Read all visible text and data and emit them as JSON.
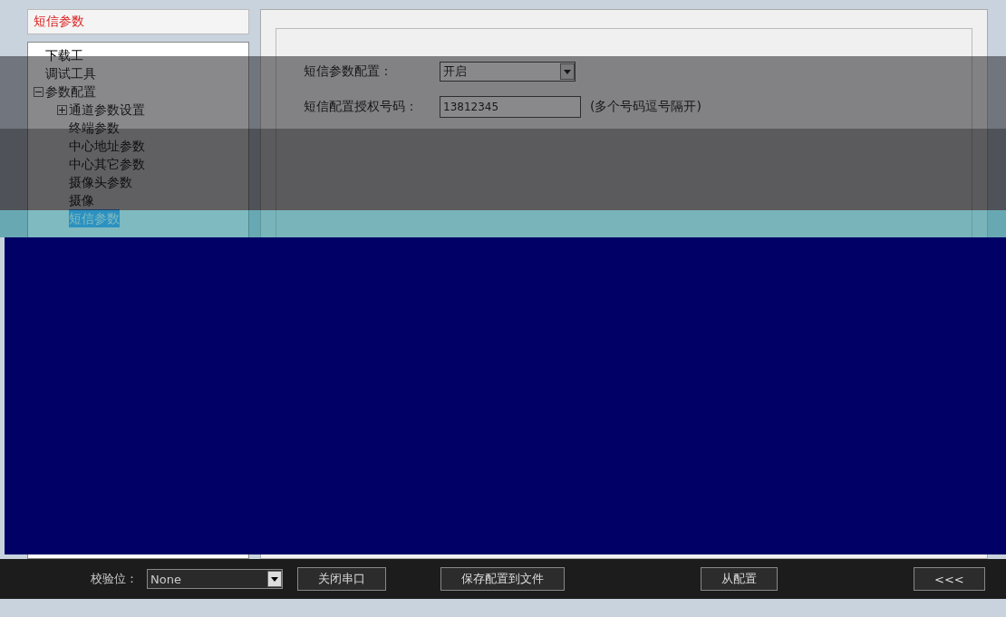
{
  "sidebar": {
    "title": "短信参数",
    "tree": [
      {
        "label": "下载工",
        "selected": false
      },
      {
        "label": "调试工具",
        "selected": false
      },
      {
        "label": "参数配置",
        "selected": false,
        "expanded": true,
        "children": [
          {
            "label": "通道参数设置",
            "selected": false,
            "expanded": false
          },
          {
            "label": "终端参数",
            "selected": false
          },
          {
            "label": "中心地址参数",
            "selected": false
          },
          {
            "label": "中心其它参数",
            "selected": false
          },
          {
            "label": "摄像头参数",
            "selected": false
          },
          {
            "label": "摄像",
            "selected": false
          },
          {
            "label": "短信参数",
            "selected": true
          }
        ]
      }
    ]
  },
  "form": {
    "fields": [
      {
        "kind": "select",
        "label": "短信参数配置：",
        "value": "开启"
      },
      {
        "kind": "text",
        "label": "短信配置授权号码：",
        "value": "13812345",
        "hint": "(多个号码逗号隔开)"
      }
    ]
  },
  "serial": {
    "label": "校验位：",
    "value": "None",
    "button": "关闭串口"
  },
  "buttons": [
    "保存配置到文件",
    "从配置",
    "<<<"
  ]
}
